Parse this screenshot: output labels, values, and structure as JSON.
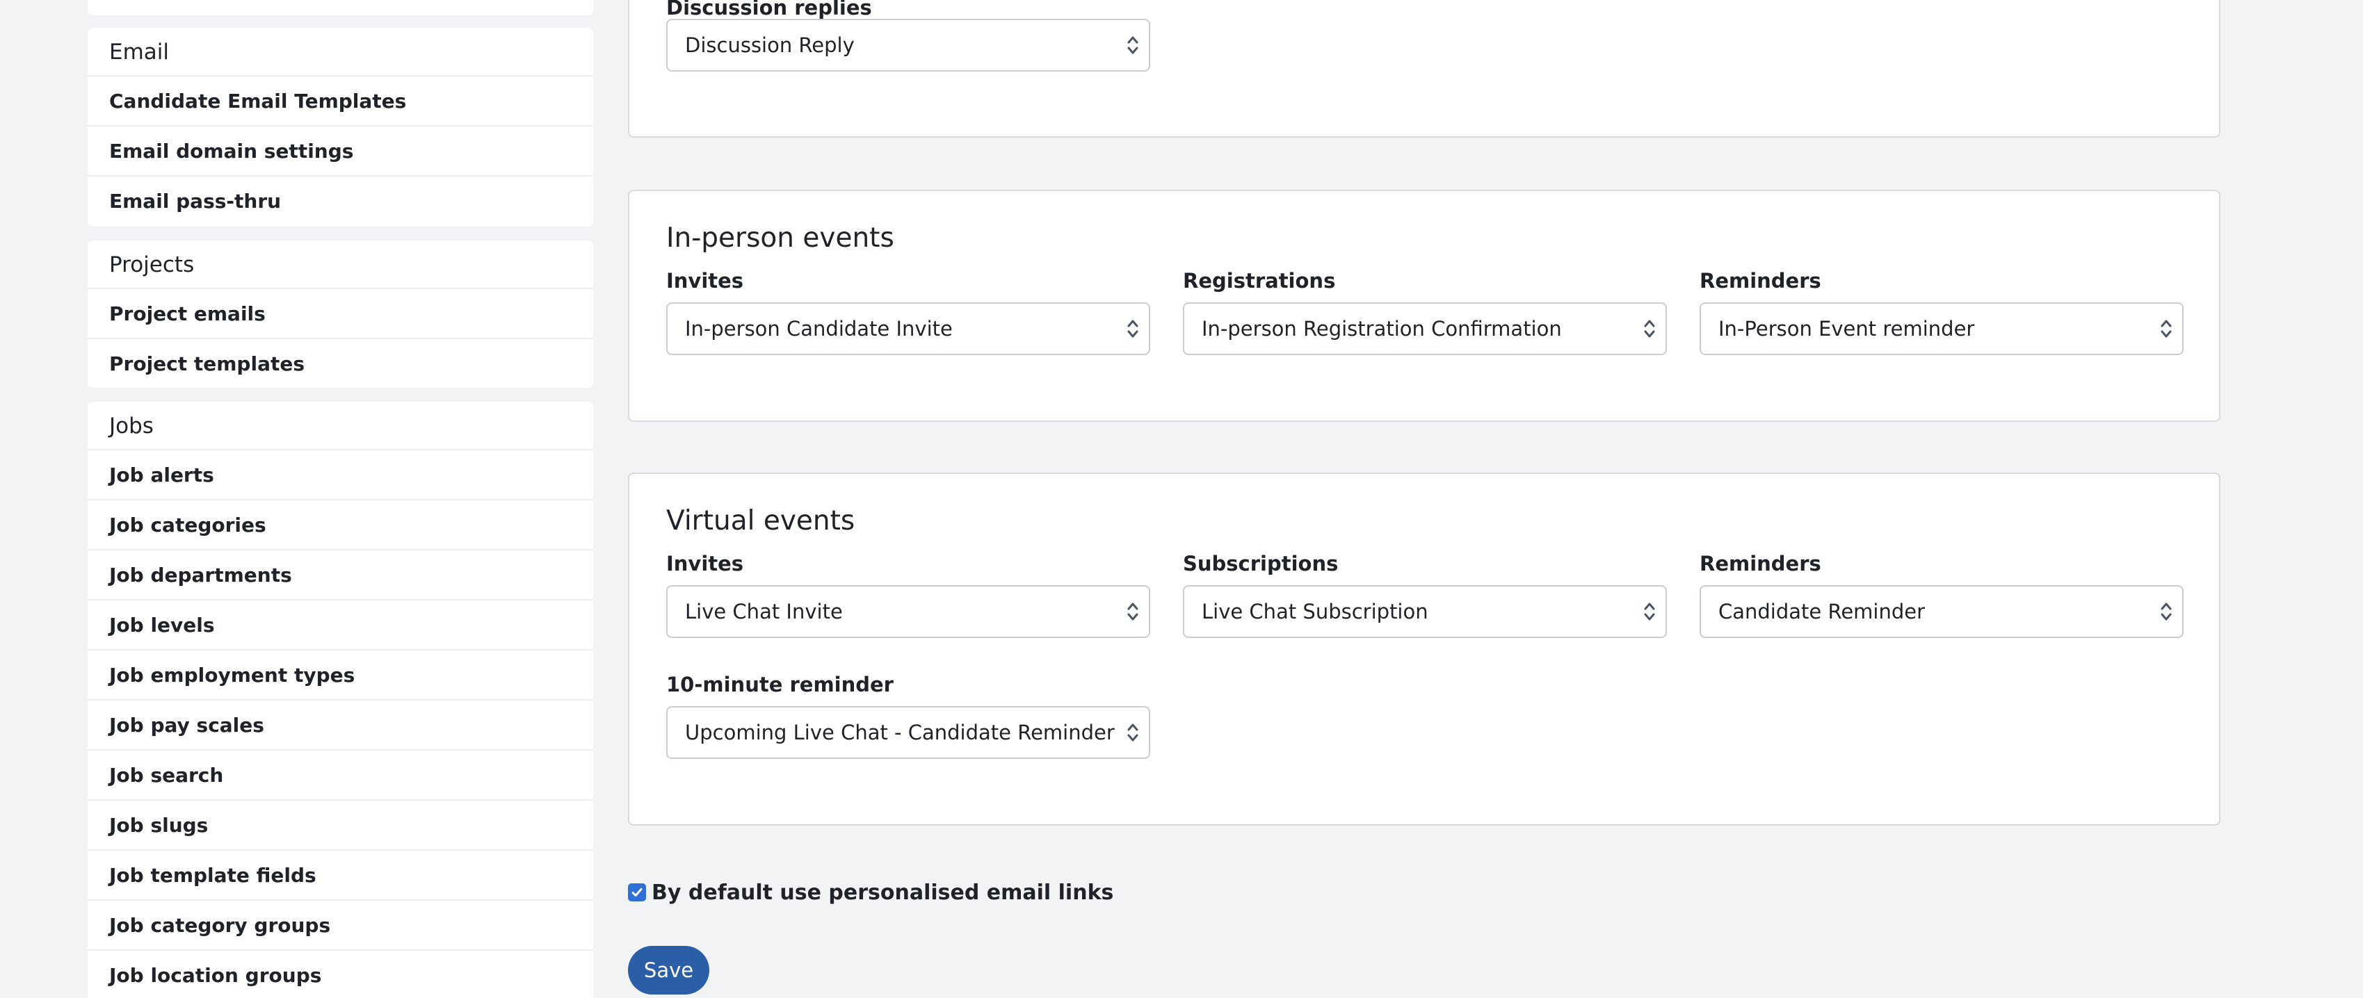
{
  "sidebar": {
    "email": {
      "heading": "Email",
      "items": [
        "Candidate Email Templates",
        "Email domain settings",
        "Email pass-thru"
      ]
    },
    "projects": {
      "heading": "Projects",
      "items": [
        "Project emails",
        "Project templates"
      ]
    },
    "jobs": {
      "heading": "Jobs",
      "items": [
        "Job alerts",
        "Job categories",
        "Job departments",
        "Job levels",
        "Job employment types",
        "Job pay scales",
        "Job search",
        "Job slugs",
        "Job template fields",
        "Job category groups",
        "Job location groups"
      ]
    }
  },
  "discussion": {
    "label": "Discussion replies",
    "value": "Discussion Reply"
  },
  "inperson": {
    "title": "In-person events",
    "invites": {
      "label": "Invites",
      "value": "In-person Candidate Invite"
    },
    "registrations": {
      "label": "Registrations",
      "value": "In-person Registration Confirmation"
    },
    "reminders": {
      "label": "Reminders",
      "value": "In-Person Event reminder"
    }
  },
  "virtual": {
    "title": "Virtual events",
    "invites": {
      "label": "Invites",
      "value": "Live Chat Invite"
    },
    "subscriptions": {
      "label": "Subscriptions",
      "value": "Live Chat Subscription"
    },
    "reminders": {
      "label": "Reminders",
      "value": "Candidate Reminder"
    },
    "ten_minute": {
      "label": "10-minute reminder",
      "value": "Upcoming Live Chat - Candidate Reminder"
    }
  },
  "personalised_links": {
    "label": "By default use personalised email links",
    "checked": true
  },
  "save_label": "Save",
  "colors": {
    "background": "#f2f3f5",
    "primary_button": "#2a5fa8",
    "checkbox": "#2f6fd6"
  },
  "icons": {
    "select_arrow": "updown-chevron-icon",
    "checkbox_mark": "check-icon"
  }
}
